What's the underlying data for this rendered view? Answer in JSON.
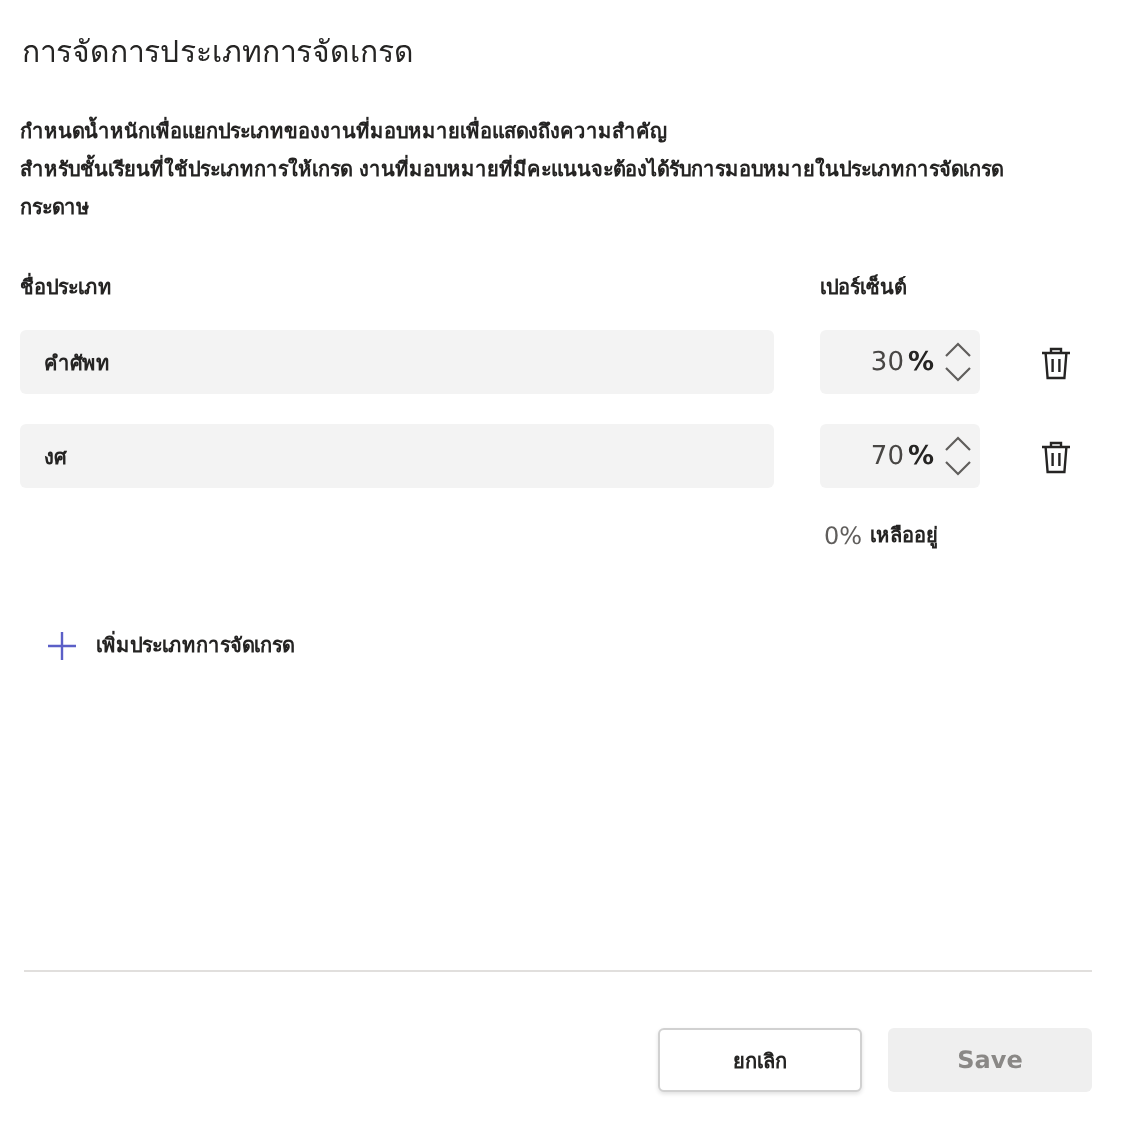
{
  "title": "การจัดการประเภทการจัดเกรด",
  "description": [
    "กำหนดน้ำหนักเพื่อแยกประเภทของงานที่มอบหมายเพื่อแสดงถึงความสำคัญ",
    "สำหรับชั้นเรียนที่ใช้ประเภทการให้เกรด งานที่มอบหมายที่มีคะแนนจะต้องได้รับการมอบหมายในประเภทการจัดเกรด",
    "กระดาษ"
  ],
  "columns": [
    "ชื่อประเภท",
    "เปอร์เซ็นต์"
  ],
  "categories": [
    {
      "name": "คำศัพท",
      "percent": "30",
      "unit": "%"
    },
    {
      "name": "งศ",
      "percent": "70",
      "unit": "%"
    }
  ],
  "remaining": {
    "value": "0%",
    "label": "เหลืออยู่"
  },
  "add_button": "เพิ่มประเภทการจัดเกรด",
  "buttons": [
    {
      "label": "ยกเลิก",
      "disabled": false
    },
    {
      "label": "Save",
      "disabled": true
    }
  ]
}
